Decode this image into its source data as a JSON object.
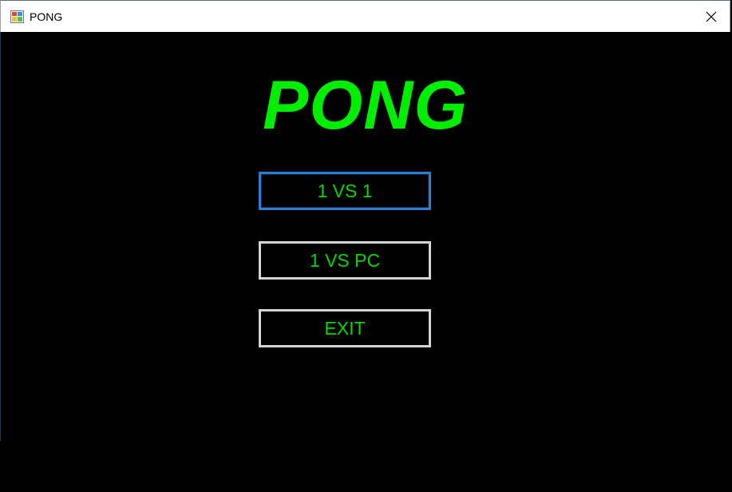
{
  "window": {
    "title": "PONG",
    "app_icon": "winforms-app-icon",
    "close_icon": "close-icon"
  },
  "menu": {
    "title": "PONG",
    "buttons": [
      {
        "label": "1 VS 1",
        "focused": true
      },
      {
        "label": "1 VS PC",
        "focused": false
      },
      {
        "label": "EXIT",
        "focused": false
      }
    ]
  },
  "colors": {
    "background": "#000000",
    "title_green": "#00ee00",
    "button_text": "#00d800",
    "button_border": "#d4d4d4",
    "focus_border": "#2a7fd4"
  }
}
